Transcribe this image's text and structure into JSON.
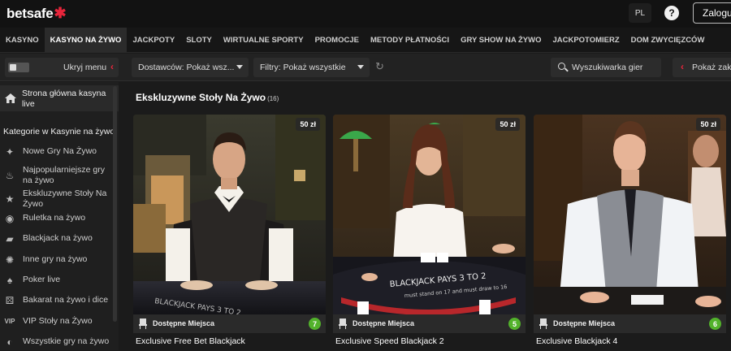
{
  "header": {
    "logo": "betsafe",
    "lang": "PL",
    "help": "?",
    "login_label": "Zaloguj"
  },
  "nav": {
    "items": [
      "KASYNO",
      "KASYNO NA ŻYWO",
      "JACKPOTY",
      "SLOTY",
      "WIRTUALNE SPORTY",
      "PROMOCJE",
      "METODY PŁATNOŚCI",
      "GRY SHOW NA ŻYWO",
      "JACKPOTOMIERZ",
      "DOM ZWYCIĘZCÓW"
    ],
    "active": "KASYNO NA ŻYWO"
  },
  "filters": {
    "hide_menu": "Ukryj menu",
    "providers": "Dostawców: Pokaż wsz...",
    "filter": "Filtry: Pokaż wszystkie",
    "search_placeholder": "Wyszukiwarka gier",
    "show_bets": "Pokaż zakła"
  },
  "sidebar": {
    "home": "Strona główna kasyna live",
    "section_title": "Kategorie w Kasynie na żywo",
    "items": [
      {
        "label": "Nowe Gry Na Żywo",
        "icon": "sparkle-icon"
      },
      {
        "label": "Najpopularniejsze gry na żywo",
        "icon": "flame-icon"
      },
      {
        "label": "Ekskluzywne Stoły Na Żywo",
        "icon": "star-icon"
      },
      {
        "label": "Ruletka na żywo",
        "icon": "roulette-icon"
      },
      {
        "label": "Blackjack na żywo",
        "icon": "cards-icon"
      },
      {
        "label": "Inne gry na żywo",
        "icon": "chip-icon"
      },
      {
        "label": "Poker live",
        "icon": "spade-icon"
      },
      {
        "label": "Bakarat na żywo i dice",
        "icon": "dice-icon"
      },
      {
        "label": "VIP Stoły na Żywo",
        "icon": "vip-icon"
      },
      {
        "label": "Wszystkie gry na żywo",
        "icon": "all-games-icon"
      }
    ]
  },
  "main": {
    "title": "Ekskluzywne Stoły Na Żywo",
    "count": "(16)",
    "cards": [
      {
        "name": "Exclusive Free Bet Blackjack",
        "limit": "50 zł",
        "seats_label": "Dostępne Miejsca",
        "seats": "7"
      },
      {
        "name": "Exclusive Speed Blackjack 2",
        "limit": "50 zł",
        "seats_label": "Dostępne Miejsca",
        "seats": "5"
      },
      {
        "name": "Exclusive Blackjack 4",
        "limit": "50 zł",
        "seats_label": "Dostępne Miejsca",
        "seats": "6"
      }
    ]
  },
  "colors": {
    "accent": "#e8253b",
    "seat_badge": "#52b22b",
    "background": "#1b1b1b"
  }
}
